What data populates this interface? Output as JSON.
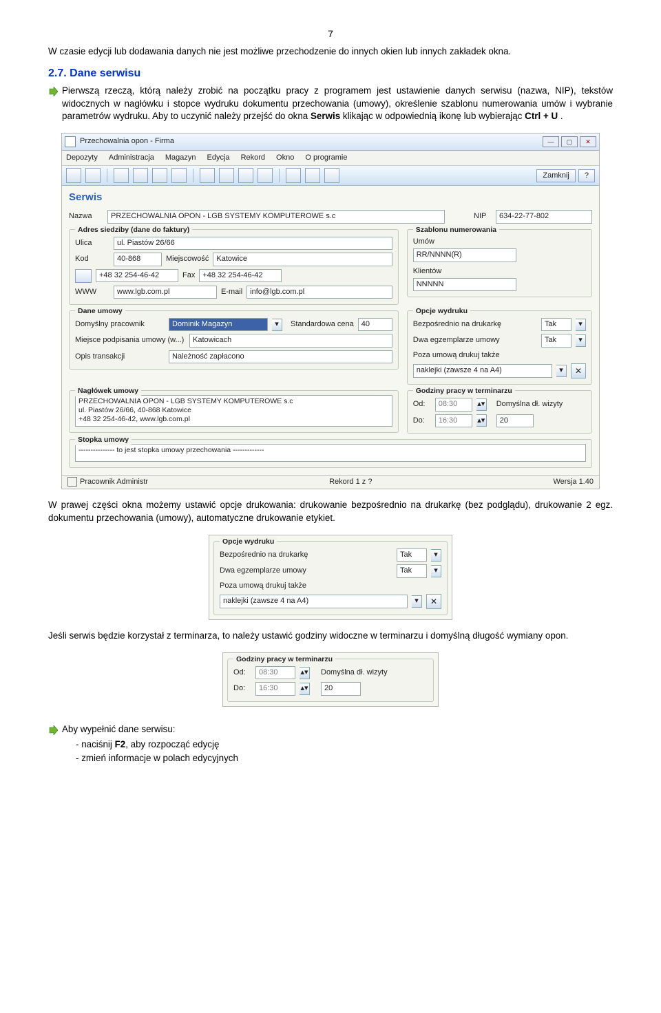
{
  "page_number": "7",
  "p1": "W czasie edycji lub dodawania danych nie jest możliwe przechodzenie do innych okien lub innych zakładek okna.",
  "h27": "2.7. Dane serwisu",
  "p2a": "Pierwszą rzeczą, którą należy zrobić na początku pracy z programem jest ustawienie danych serwisu (nazwa, NIP), tekstów widocznych w nagłówku i stopce wydruku dokumentu przechowania (umowy), określenie szablonu numerowania umów i wybranie parametrów wydruku. Aby to uczynić należy przejść do okna ",
  "p2b": "Serwis",
  "p2c": " klikając w odpowiednią ikonę lub wybierając ",
  "p2d": "Ctrl + U",
  "p2e": ".",
  "shot1": {
    "title": "Przechowalnia opon - Firma",
    "menu": [
      "Depozyty",
      "Administracja",
      "Magazyn",
      "Edycja",
      "Rekord",
      "Okno",
      "O programie"
    ],
    "zamknij": "Zamknij",
    "serwis": "Serwis",
    "labels": {
      "nazwa": "Nazwa",
      "nip": "NIP",
      "grp_addr": "Adres siedziby (dane do faktury)",
      "ulica": "Ulica",
      "kod": "Kod",
      "miejscowosc": "Miejscowość",
      "fax": "Fax",
      "www": "WWW",
      "email": "E-mail",
      "grp_szabl": "Szablonu numerowania",
      "umow": "Umów",
      "klientow": "Klientów",
      "grp_daneum": "Dane umowy",
      "dom_prac": "Domyślny pracownik",
      "std_cena": "Standardowa cena",
      "miejsce": "Miejsce podpisania umowy (w...)",
      "opis": "Opis transakcji",
      "grp_opcje": "Opcje wydruku",
      "bezp": "Bezpośrednio na drukarkę",
      "dwa": "Dwa egzemplarze umowy",
      "poza": "Poza umową drukuj także",
      "grp_nagl": "Nagłówek umowy",
      "grp_stop": "Stopka umowy",
      "grp_god": "Godziny pracy w terminarzu",
      "od": "Od:",
      "do": "Do:",
      "dl": "Domyślna dł. wizyty",
      "status_l": "Pracownik Administr",
      "status_m": "Rekord 1 z ?",
      "status_r": "Wersja 1.40"
    },
    "vals": {
      "nazwa": "PRZECHOWALNIA OPON - LGB SYSTEMY KOMPUTEROWE s.c",
      "nip": "634-22-77-802",
      "ulica": "ul. Piastów 26/66",
      "kod": "40-868",
      "miejscowosc": "Katowice",
      "tel": "+48 32 254-46-42",
      "fax": "+48 32 254-46-42",
      "www": "www.lgb.com.pl",
      "email": "info@lgb.com.pl",
      "umow": "RR/NNNN(R)",
      "klientow": "NNNNN",
      "dom_prac": "Dominik Magazyn",
      "std_cena": "40",
      "miejsce": "Katowicach",
      "opis": "Należność zapłacono",
      "bezp": "Tak",
      "dwa": "Tak",
      "poza": "naklejki (zawsze 4 na A4)",
      "nagl": "PRZECHOWALNIA OPON - LGB SYSTEMY KOMPUTEROWE s.c\nul. Piastów 26/66, 40-868 Katowice\n+48 32 254-46-42, www.lgb.com.pl",
      "stopka": "--------------- to jest stopka umowy przechowania -------------",
      "od": "08:30",
      "do": "16:30",
      "dl": "20"
    }
  },
  "p3": "W prawej części okna możemy ustawić opcje drukowania: drukowanie bezpośrednio na drukarkę (bez podglądu), drukowanie 2 egz. dokumentu przechowania (umowy), automatyczne drukowanie etykiet.",
  "shot2": {
    "grp": "Opcje wydruku",
    "bezp": "Bezpośrednio na drukarkę",
    "bezp_v": "Tak",
    "dwa": "Dwa egzemplarze umowy",
    "dwa_v": "Tak",
    "poza": "Poza umową drukuj także",
    "poza_v": "naklejki (zawsze 4 na A4)"
  },
  "p4": "Jeśli serwis będzie korzystał z terminarza, to należy ustawić godziny widoczne w terminarzu i domyślną długość wymiany opon.",
  "shot3": {
    "grp": "Godziny pracy w terminarzu",
    "od": "Od:",
    "od_v": "08:30",
    "do": "Do:",
    "do_v": "16:30",
    "dl": "Domyślna dł. wizyty",
    "dl_v": "20"
  },
  "p5": "Aby wypełnić dane serwisu:",
  "b1a": "naciśnij ",
  "b1b": "F2",
  "b1c": ", aby rozpocząć edycję",
  "b2": "zmień informacje w polach edycyjnych"
}
